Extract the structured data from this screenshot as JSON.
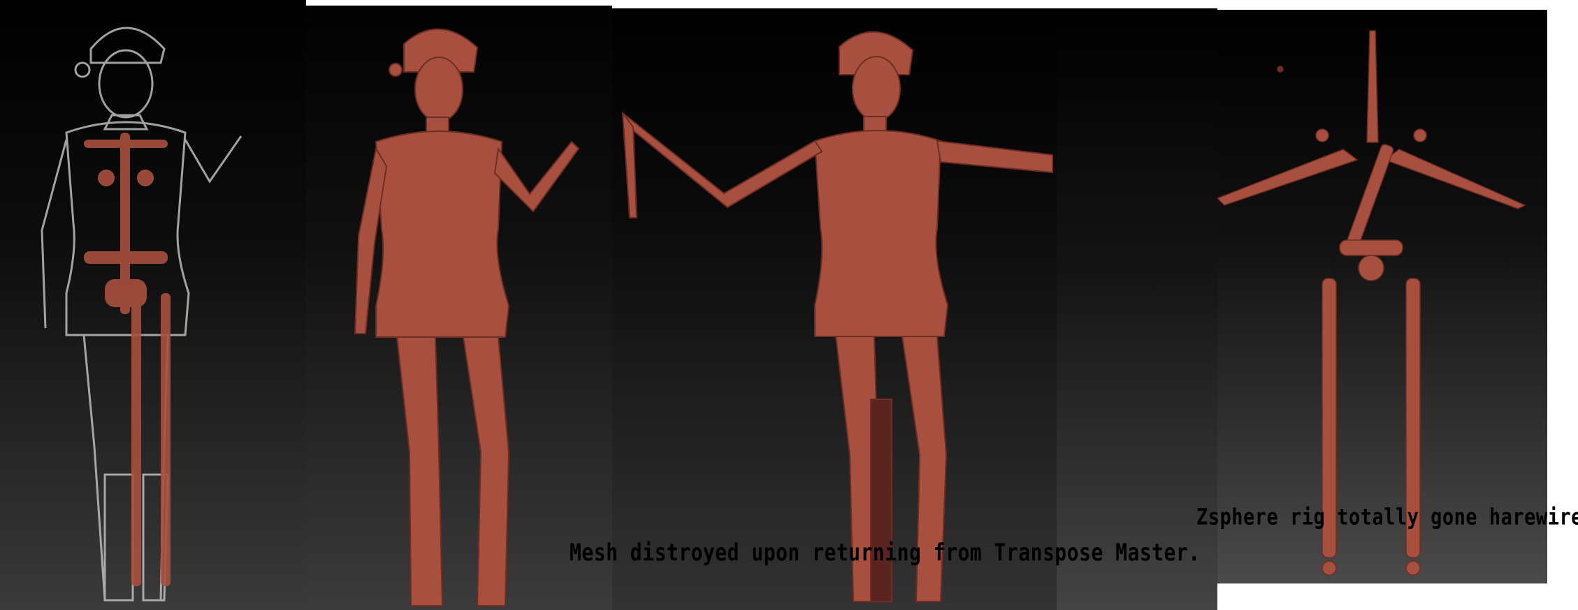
{
  "captions": {
    "mesh_destroyed": "Mesh distroyed upon returning from Transpose Master.",
    "rig_haywire": "Zsphere rig totally gone harewire!"
  },
  "colors": {
    "mesh": "#a8503f",
    "mesh_dark": "#6e2c22",
    "ghost": "#9a9a9a"
  }
}
